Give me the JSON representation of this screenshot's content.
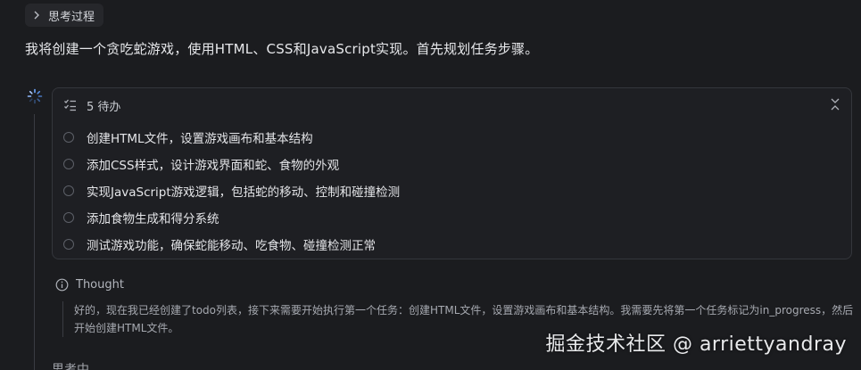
{
  "thinking_toggle": {
    "label": "思考过程",
    "icon": "chevron-right-icon"
  },
  "intro": "我将创建一个贪吃蛇游戏，使用HTML、CSS和JavaScript实现。首先规划任务步骤。",
  "todo": {
    "header": "5 待办",
    "items": [
      {
        "label": "创建HTML文件，设置游戏画布和基本结构"
      },
      {
        "label": "添加CSS样式，设计游戏界面和蛇、食物的外观"
      },
      {
        "label": "实现JavaScript游戏逻辑，包括蛇的移动、控制和碰撞检测"
      },
      {
        "label": "添加食物生成和得分系统"
      },
      {
        "label": "测试游戏功能，确保蛇能移动、吃食物、碰撞检测正常"
      }
    ]
  },
  "thought": {
    "label": "Thought",
    "text": "好的，现在我已经创建了todo列表，接下来需要开始执行第一个任务：创建HTML文件，设置游戏画布和基本结构。我需要先将第一个任务标记为in_progress，然后开始创建HTML文件。"
  },
  "status": "思考中",
  "watermark": "掘金技术社区 @ arriettyandray",
  "colors": {
    "background": "#1b1c1f",
    "card_border": "#34363c",
    "text_primary": "#e4e5e8",
    "text_muted": "#a6a9b0"
  }
}
